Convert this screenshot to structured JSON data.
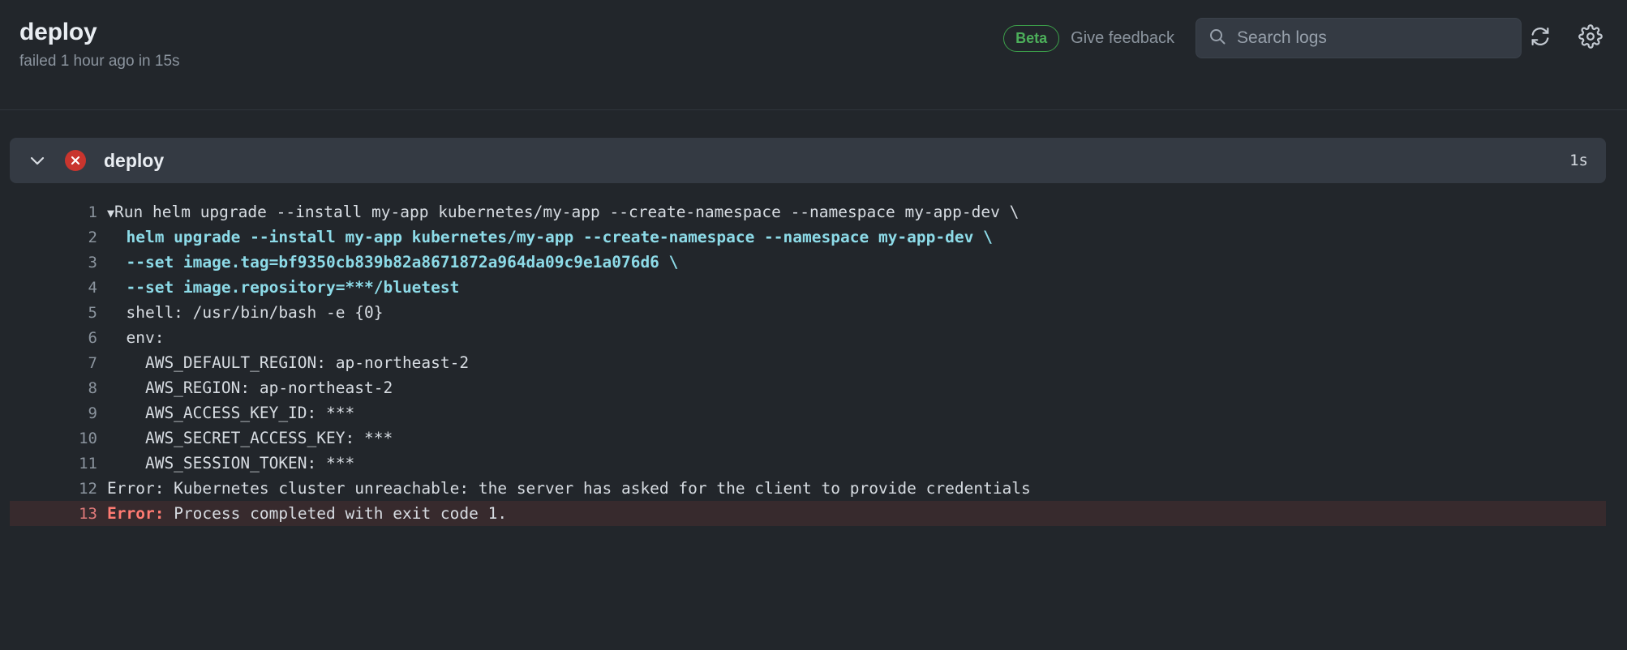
{
  "header": {
    "title": "deploy",
    "subtitle": "failed 1 hour ago in 15s",
    "beta_label": "Beta",
    "feedback_label": "Give feedback",
    "search_placeholder": "Search logs",
    "refresh_icon": "refresh-icon",
    "settings_icon": "gear-icon",
    "search_icon": "search-icon"
  },
  "job": {
    "name": "deploy",
    "duration": "1s",
    "status": "failed",
    "status_icon": "error-circle-x-icon",
    "chevron_icon": "chevron-down-icon"
  },
  "log": {
    "lines": [
      {
        "n": "1",
        "text": "Run helm upgrade --install my-app kubernetes/my-app --create-namespace --namespace my-app-dev \\",
        "style": "plain",
        "marker": "▼"
      },
      {
        "n": "2",
        "text": "  helm upgrade --install my-app kubernetes/my-app --create-namespace --namespace my-app-dev \\",
        "style": "cmd"
      },
      {
        "n": "3",
        "text": "  --set image.tag=bf9350cb839b82a8671872a964da09c9e1a076d6 \\",
        "style": "cmd"
      },
      {
        "n": "4",
        "text": "  --set image.repository=***/bluetest",
        "style": "cmd"
      },
      {
        "n": "5",
        "text": "  shell: /usr/bin/bash -e {0}",
        "style": "plain"
      },
      {
        "n": "6",
        "text": "  env:",
        "style": "plain"
      },
      {
        "n": "7",
        "text": "    AWS_DEFAULT_REGION: ap-northeast-2",
        "style": "plain"
      },
      {
        "n": "8",
        "text": "    AWS_REGION: ap-northeast-2",
        "style": "plain"
      },
      {
        "n": "9",
        "text": "    AWS_ACCESS_KEY_ID: ***",
        "style": "plain"
      },
      {
        "n": "10",
        "text": "    AWS_SECRET_ACCESS_KEY: ***",
        "style": "plain"
      },
      {
        "n": "11",
        "text": "    AWS_SESSION_TOKEN: ***",
        "style": "plain"
      },
      {
        "n": "12",
        "text": "Error: Kubernetes cluster unreachable: the server has asked for the client to provide credentials",
        "style": "plain"
      },
      {
        "n": "13",
        "text": "Process completed with exit code 1.",
        "style": "error",
        "prefix": "Error:"
      }
    ]
  },
  "colors": {
    "page_bg": "#22262b",
    "card_bg": "#343a43",
    "accent_cyan": "#8ddbe8",
    "error_red": "#ff7b72",
    "error_bg": "#372a2d",
    "status_red": "#c9352e",
    "beta_green": "#4cae5a"
  }
}
